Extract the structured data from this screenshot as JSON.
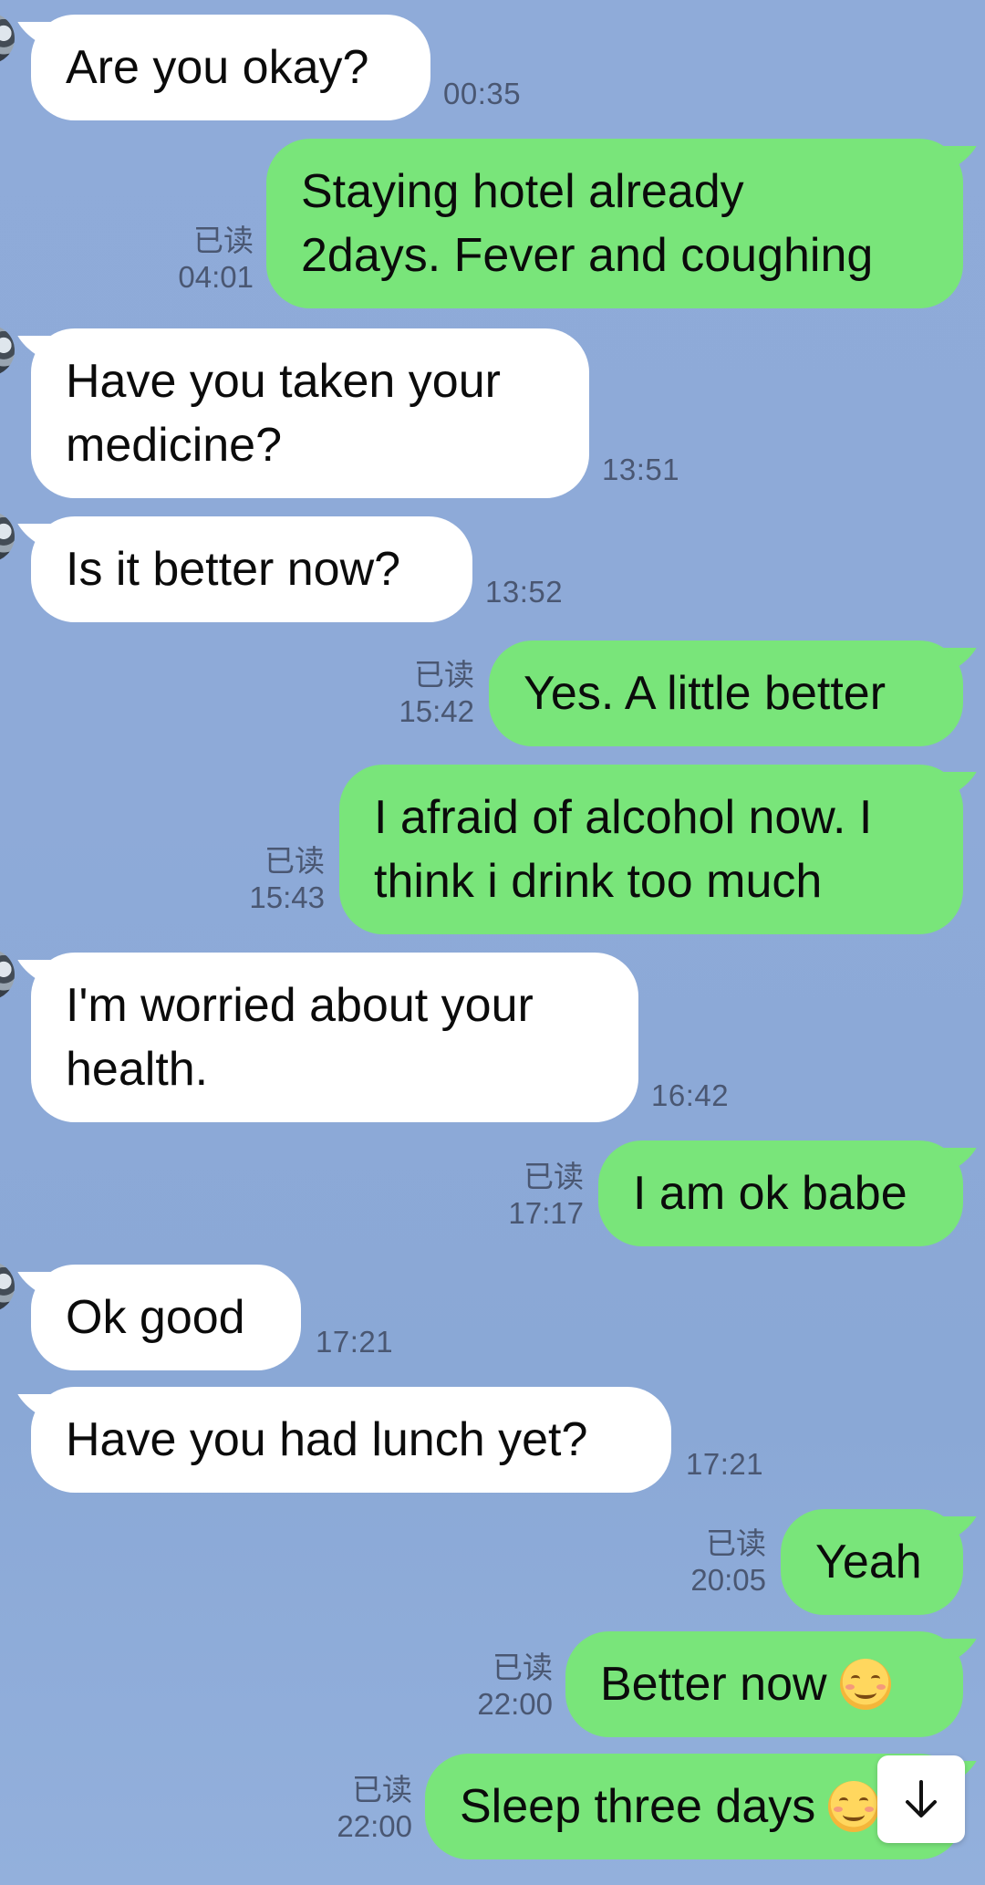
{
  "chat": {
    "read_label": "已读",
    "messages": [
      {
        "direction": "in",
        "lines": [
          "Are you okay?"
        ],
        "time": "00:35"
      },
      {
        "direction": "out",
        "lines": [
          "Staying hotel already",
          "2days. Fever and coughing"
        ],
        "time": "04:01"
      },
      {
        "direction": "in",
        "lines": [
          "Have you taken your",
          "medicine?"
        ],
        "time": "13:51"
      },
      {
        "direction": "in",
        "lines": [
          "Is it better now?"
        ],
        "time": "13:52"
      },
      {
        "direction": "out",
        "lines": [
          "Yes. A little better"
        ],
        "time": "15:42"
      },
      {
        "direction": "out",
        "lines": [
          "I afraid of alcohol now. I",
          "think i drink too much"
        ],
        "time": "15:43"
      },
      {
        "direction": "in",
        "lines": [
          "I'm worried about your",
          "health."
        ],
        "time": "16:42"
      },
      {
        "direction": "out",
        "lines": [
          "I am ok babe"
        ],
        "time": "17:17"
      },
      {
        "direction": "in",
        "lines": [
          "Ok good"
        ],
        "time": "17:21"
      },
      {
        "direction": "in",
        "lines": [
          "Have you had lunch yet?"
        ],
        "time": "17:21"
      },
      {
        "direction": "out",
        "lines": [
          "Yeah"
        ],
        "time": "20:05"
      },
      {
        "direction": "out",
        "lines": [
          "Better now"
        ],
        "emoji": "smiling-face-emoji",
        "time": "22:00"
      },
      {
        "direction": "out",
        "lines": [
          "Sleep three days"
        ],
        "emoji": "smiling-face-emoji",
        "time": "22:00"
      }
    ]
  },
  "scroll_button": {
    "icon": "arrow-down-icon"
  },
  "colors": {
    "background": "#8eaad8",
    "incoming_bubble": "#ffffff",
    "outgoing_bubble": "#79e57a",
    "meta_text": "#4a5772"
  }
}
